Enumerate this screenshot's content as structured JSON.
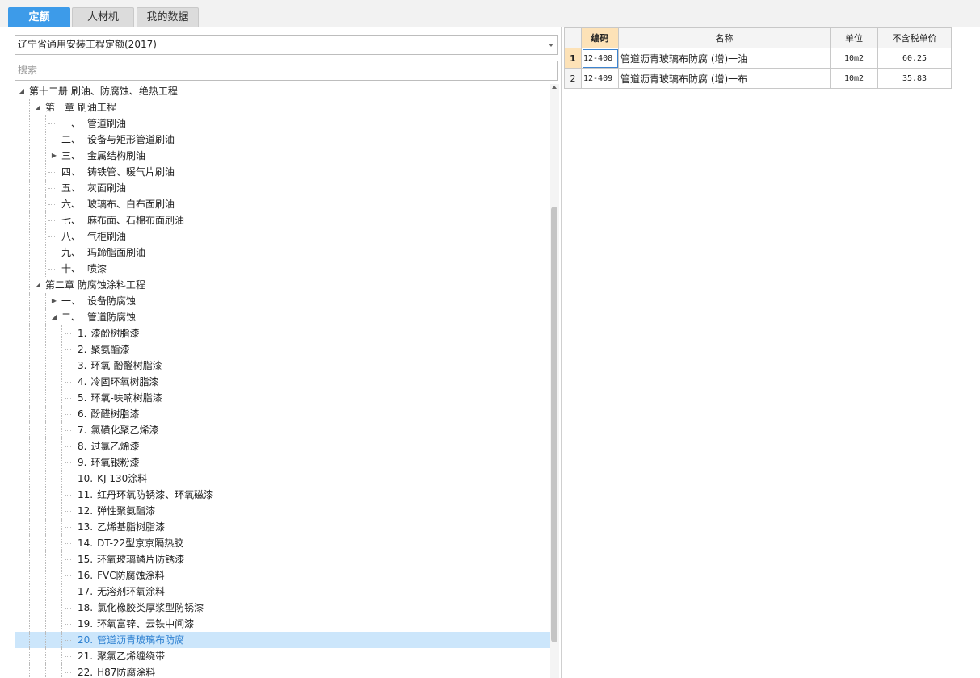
{
  "tabs": [
    {
      "label": "定额",
      "active": true
    },
    {
      "label": "人材机",
      "active": false
    },
    {
      "label": "我的数据",
      "active": false
    }
  ],
  "library_select": {
    "value": "辽宁省通用安装工程定额(2017)"
  },
  "search": {
    "placeholder": "搜索"
  },
  "tree": [
    {
      "level": 0,
      "num": "",
      "label": "第十二册 刷油、防腐蚀、绝热工程",
      "toggle": "expanded"
    },
    {
      "level": 1,
      "num": "",
      "label": "第一章 刷油工程",
      "toggle": "expanded"
    },
    {
      "level": 2,
      "num": "一、",
      "label": "管道刷油",
      "toggle": "none"
    },
    {
      "level": 2,
      "num": "二、",
      "label": "设备与矩形管道刷油",
      "toggle": "none"
    },
    {
      "level": 2,
      "num": "三、",
      "label": "金属结构刷油",
      "toggle": "collapsed"
    },
    {
      "level": 2,
      "num": "四、",
      "label": "铸铁管、暖气片刷油",
      "toggle": "none"
    },
    {
      "level": 2,
      "num": "五、",
      "label": "灰面刷油",
      "toggle": "none"
    },
    {
      "level": 2,
      "num": "六、",
      "label": "玻璃布、白布面刷油",
      "toggle": "none"
    },
    {
      "level": 2,
      "num": "七、",
      "label": "麻布面、石棉布面刷油",
      "toggle": "none"
    },
    {
      "level": 2,
      "num": "八、",
      "label": "气柜刷油",
      "toggle": "none"
    },
    {
      "level": 2,
      "num": "九、",
      "label": "玛蹄脂面刷油",
      "toggle": "none"
    },
    {
      "level": 2,
      "num": "十、",
      "label": "喷漆",
      "toggle": "none"
    },
    {
      "level": 1,
      "num": "",
      "label": "第二章 防腐蚀涂料工程",
      "toggle": "expanded"
    },
    {
      "level": 2,
      "num": "一、",
      "label": "设备防腐蚀",
      "toggle": "collapsed"
    },
    {
      "level": 2,
      "num": "二、",
      "label": "管道防腐蚀",
      "toggle": "expanded"
    },
    {
      "level": 3,
      "num": "1.",
      "label": "漆酚树脂漆",
      "toggle": "none"
    },
    {
      "level": 3,
      "num": "2.",
      "label": "聚氨酯漆",
      "toggle": "none"
    },
    {
      "level": 3,
      "num": "3.",
      "label": "环氧-酚醛树脂漆",
      "toggle": "none"
    },
    {
      "level": 3,
      "num": "4.",
      "label": "冷固环氧树脂漆",
      "toggle": "none"
    },
    {
      "level": 3,
      "num": "5.",
      "label": "环氧-呋喃树脂漆",
      "toggle": "none"
    },
    {
      "level": 3,
      "num": "6.",
      "label": "酚醛树脂漆",
      "toggle": "none"
    },
    {
      "level": 3,
      "num": "7.",
      "label": "氯磺化聚乙烯漆",
      "toggle": "none"
    },
    {
      "level": 3,
      "num": "8.",
      "label": "过氯乙烯漆",
      "toggle": "none"
    },
    {
      "level": 3,
      "num": "9.",
      "label": "环氧银粉漆",
      "toggle": "none"
    },
    {
      "level": 3,
      "num": "10.",
      "label": "KJ-130涂料",
      "toggle": "none"
    },
    {
      "level": 3,
      "num": "11.",
      "label": "红丹环氧防锈漆、环氧磁漆",
      "toggle": "none"
    },
    {
      "level": 3,
      "num": "12.",
      "label": "弹性聚氨酯漆",
      "toggle": "none"
    },
    {
      "level": 3,
      "num": "13.",
      "label": "乙烯基脂树脂漆",
      "toggle": "none"
    },
    {
      "level": 3,
      "num": "14.",
      "label": "DT-22型京京隔热胶",
      "toggle": "none"
    },
    {
      "level": 3,
      "num": "15.",
      "label": "环氧玻璃鳞片防锈漆",
      "toggle": "none"
    },
    {
      "level": 3,
      "num": "16.",
      "label": "FVC防腐蚀涂料",
      "toggle": "none"
    },
    {
      "level": 3,
      "num": "17.",
      "label": "无溶剂环氧涂料",
      "toggle": "none"
    },
    {
      "level": 3,
      "num": "18.",
      "label": "氯化橡胶类厚浆型防锈漆",
      "toggle": "none"
    },
    {
      "level": 3,
      "num": "19.",
      "label": "环氧富锌、云铁中间漆",
      "toggle": "none"
    },
    {
      "level": 3,
      "num": "20.",
      "label": "管道沥青玻璃布防腐",
      "toggle": "none",
      "selected": true
    },
    {
      "level": 3,
      "num": "21.",
      "label": "聚氯乙烯缠绕带",
      "toggle": "none"
    },
    {
      "level": 3,
      "num": "22.",
      "label": "H87防腐涂料",
      "toggle": "none"
    }
  ],
  "grid": {
    "columns": [
      "编码",
      "名称",
      "单位",
      "不含税单价"
    ],
    "rows": [
      {
        "index": "1",
        "code": "12-408",
        "name": "管道沥青玻璃布防腐 (增)一油",
        "unit": "10m2",
        "price": "60.25",
        "current": true
      },
      {
        "index": "2",
        "code": "12-409",
        "name": "管道沥青玻璃布防腐 (增)一布",
        "unit": "10m2",
        "price": "35.83",
        "current": false
      }
    ]
  },
  "colors": {
    "accent": "#3d9be9",
    "selected_row": "#cce6fb",
    "header_active": "#fde2b7"
  }
}
